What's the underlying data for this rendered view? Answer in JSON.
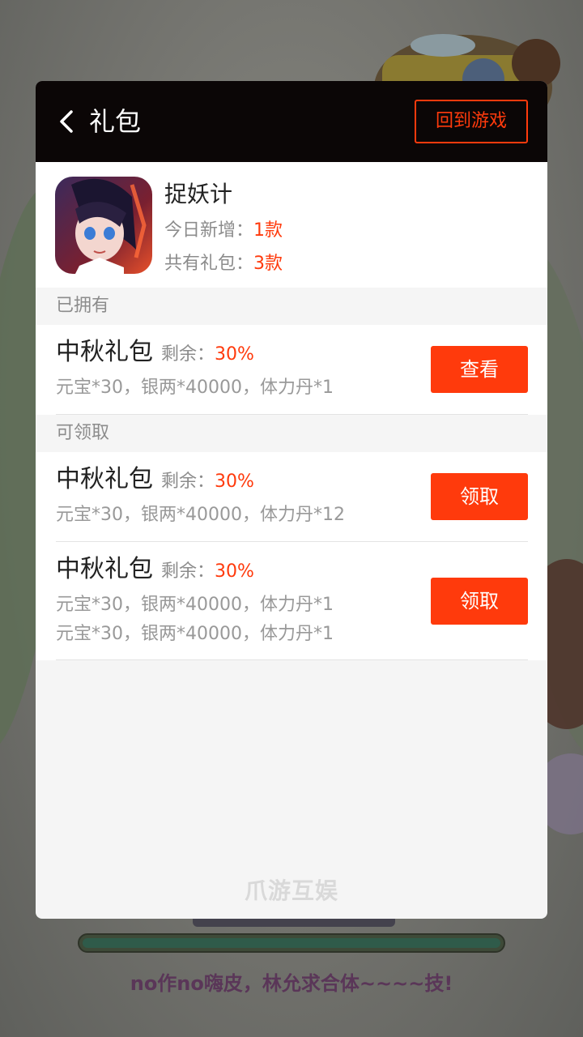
{
  "background": {
    "loading_tip": "no作no嗨皮，林允求合体~~~~技!",
    "progress_fraction": 1.0
  },
  "dialog": {
    "title": "礼包",
    "return_button": "回到游戏"
  },
  "game": {
    "name": "捉妖计",
    "today_new_label": "今日新增：",
    "today_new_value": "1款",
    "total_label": "共有礼包：",
    "total_value": "3款"
  },
  "owned": {
    "section_label": "已拥有",
    "items": [
      {
        "name": "中秋礼包",
        "remain_label": "剩余：",
        "remain_value": "30%",
        "desc_lines": [
          "元宝*30，银两*40000，体力丹*1"
        ],
        "button": "查看"
      }
    ]
  },
  "available": {
    "section_label": "可领取",
    "items": [
      {
        "name": "中秋礼包",
        "remain_label": "剩余：",
        "remain_value": "30%",
        "desc_lines": [
          "元宝*30，银两*40000，体力丹*12"
        ],
        "button": "领取"
      },
      {
        "name": "中秋礼包",
        "remain_label": "剩余：",
        "remain_value": "30%",
        "desc_lines": [
          "元宝*30，银两*40000，体力丹*1",
          "元宝*30，银两*40000，体力丹*1"
        ],
        "button": "领取"
      }
    ]
  },
  "watermark": "爪游互娱",
  "colors": {
    "accent": "#ff3a0c",
    "header_bg": "#0b0606",
    "muted_text": "#8c8c8c"
  },
  "icons": {
    "back": "chevron-left-icon",
    "game": "game-app-icon"
  }
}
